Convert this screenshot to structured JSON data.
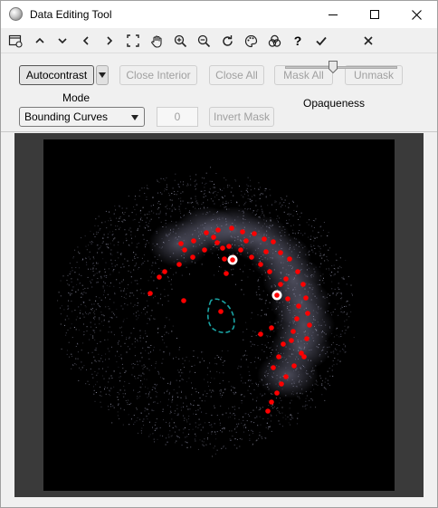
{
  "window": {
    "title": "Data Editing Tool"
  },
  "toolbar": {
    "items": [
      {
        "name": "calendar-config-icon",
        "label": ""
      },
      {
        "name": "chevron-up-icon",
        "label": ""
      },
      {
        "name": "chevron-down-icon",
        "label": ""
      },
      {
        "name": "chevron-left-icon",
        "label": ""
      },
      {
        "name": "chevron-right-icon",
        "label": ""
      },
      {
        "name": "fit-frame-icon",
        "label": ""
      },
      {
        "name": "pan-hand-icon",
        "label": ""
      },
      {
        "name": "zoom-in-icon",
        "label": ""
      },
      {
        "name": "zoom-out-icon",
        "label": ""
      },
      {
        "name": "rotate-icon",
        "label": ""
      },
      {
        "name": "palette-icon",
        "label": ""
      },
      {
        "name": "color-channels-icon",
        "label": ""
      },
      {
        "name": "help-icon",
        "label": "?"
      },
      {
        "name": "check-icon",
        "label": ""
      },
      {
        "name": "close-x-icon",
        "label": ""
      }
    ]
  },
  "panel": {
    "autocontrast_label": "Autocontrast",
    "close_interior_label": "Close Interior",
    "close_all_label": "Close All",
    "mask_all_label": "Mask All",
    "unmask_label": "Unmask",
    "mode_label": "Mode",
    "mode_value": "Bounding Curves",
    "number_value": "0",
    "invert_mask_label": "Invert Mask",
    "opaqueness_label": "Opaqueness",
    "opaqueness_value": 0.42
  },
  "image": {
    "marker_color": "#ff0000",
    "highlight_color": "#ffffff",
    "curve_color": "#1aa3a3",
    "background": "#000000"
  }
}
